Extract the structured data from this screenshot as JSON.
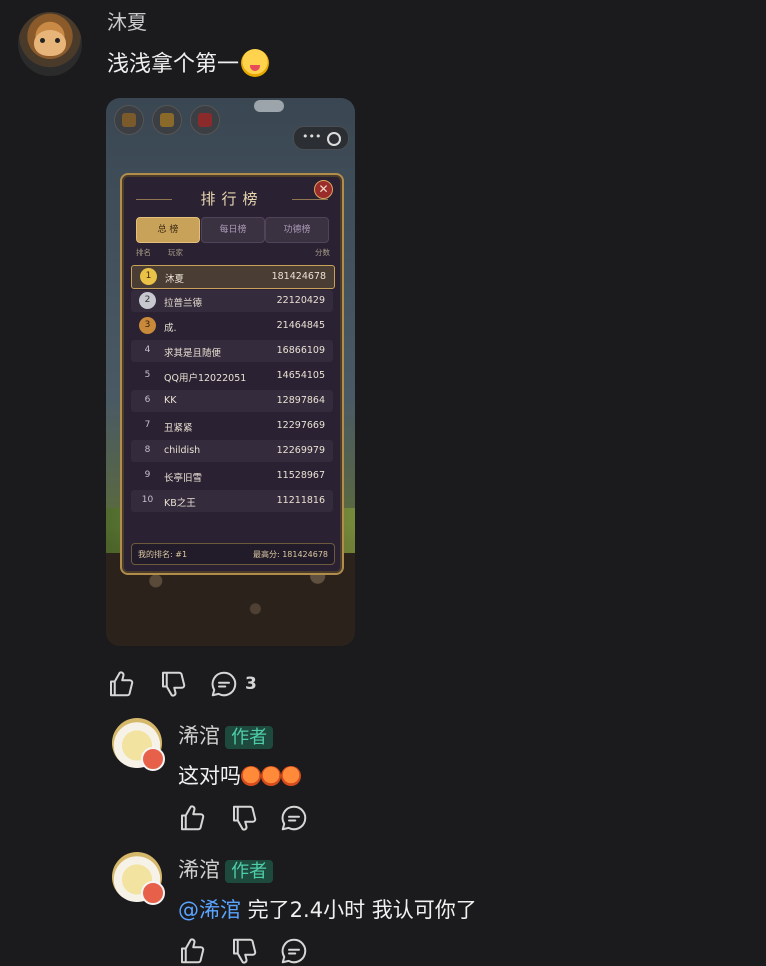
{
  "post": {
    "username": "沐夏",
    "comment": "浅浅拿个第一",
    "comment_count": "3"
  },
  "game": {
    "title": "排行榜",
    "close_symbol": "✕",
    "tabs": [
      {
        "label": "总 榜",
        "active": true
      },
      {
        "label": "每日榜",
        "active": false
      },
      {
        "label": "功德榜",
        "active": false
      }
    ],
    "columns": {
      "rank": "排名",
      "player": "玩家",
      "score": "分数"
    },
    "rows": [
      {
        "rank": "1",
        "name": "沐夏",
        "score": "181424678"
      },
      {
        "rank": "2",
        "name": "拉普兰德",
        "score": "22120429"
      },
      {
        "rank": "3",
        "name": "成.",
        "score": "21464845"
      },
      {
        "rank": "4",
        "name": "求其是且随便",
        "score": "16866109"
      },
      {
        "rank": "5",
        "name": "QQ用户12022051",
        "score": "14654105"
      },
      {
        "rank": "6",
        "name": "KK",
        "score": "12897864"
      },
      {
        "rank": "7",
        "name": "丑紧紧",
        "score": "12297669"
      },
      {
        "rank": "8",
        "name": "childish",
        "score": "12269979"
      },
      {
        "rank": "9",
        "name": "长亭旧雪",
        "score": "11528967"
      },
      {
        "rank": "10",
        "name": "KB之王",
        "score": "11211816"
      }
    ],
    "my_rank": "我的排名: #1",
    "best_score": "最高分: 181424678"
  },
  "replies": [
    {
      "author": "浠涫",
      "tag": "作者",
      "text": "这对吗"
    },
    {
      "author": "浠涫",
      "tag": "作者",
      "mention": "@浠涫",
      "text": " 完了2.4小时 我认可你了"
    }
  ],
  "icons": [
    "like-icon",
    "dislike-icon",
    "comment-icon"
  ],
  "colors": {
    "background": "#1b1b1d",
    "author_tag": "#4fcda7",
    "mention": "#5aa3ff"
  }
}
